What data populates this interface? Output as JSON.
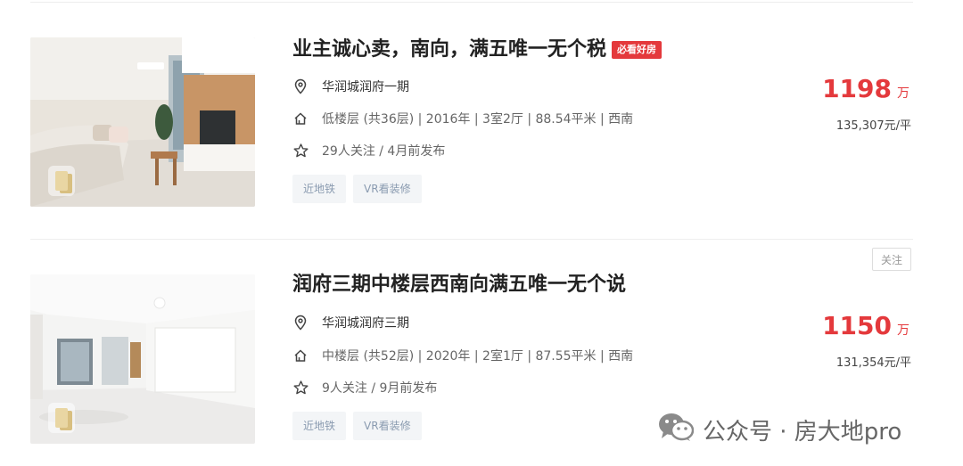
{
  "listings": [
    {
      "title": "业主诚心卖，南向，满五唯一无个税",
      "badge": "必看好房",
      "community": "华润城润府一期",
      "house_info": "低楼层 (共36层) | 2016年 | 3室2厅 | 88.54平米 | 西南",
      "follow_info": "29人关注 / 4月前发布",
      "tags": [
        "近地铁",
        "VR看装修"
      ],
      "total_price": "1198",
      "price_unit": "万",
      "unit_price": "135,307元/平"
    },
    {
      "title": "润府三期中楼层西南向满五唯一无个说",
      "community": "华润城润府三期",
      "house_info": "中楼层 (共52层) | 2020年 | 2室1厅 | 87.55平米 | 西南",
      "follow_info": "9人关注 / 9月前发布",
      "tags": [
        "近地铁",
        "VR看装修"
      ],
      "total_price": "1150",
      "price_unit": "万",
      "unit_price": "131,354元/平",
      "follow_button": "关注"
    }
  ],
  "watermark": {
    "text": "公众号 · 房大地pro",
    "icon": "wechat-icon"
  },
  "colors": {
    "price_red": "#e4393c",
    "tag_bg": "#f3f5f7",
    "tag_text": "#8a9bb0"
  }
}
